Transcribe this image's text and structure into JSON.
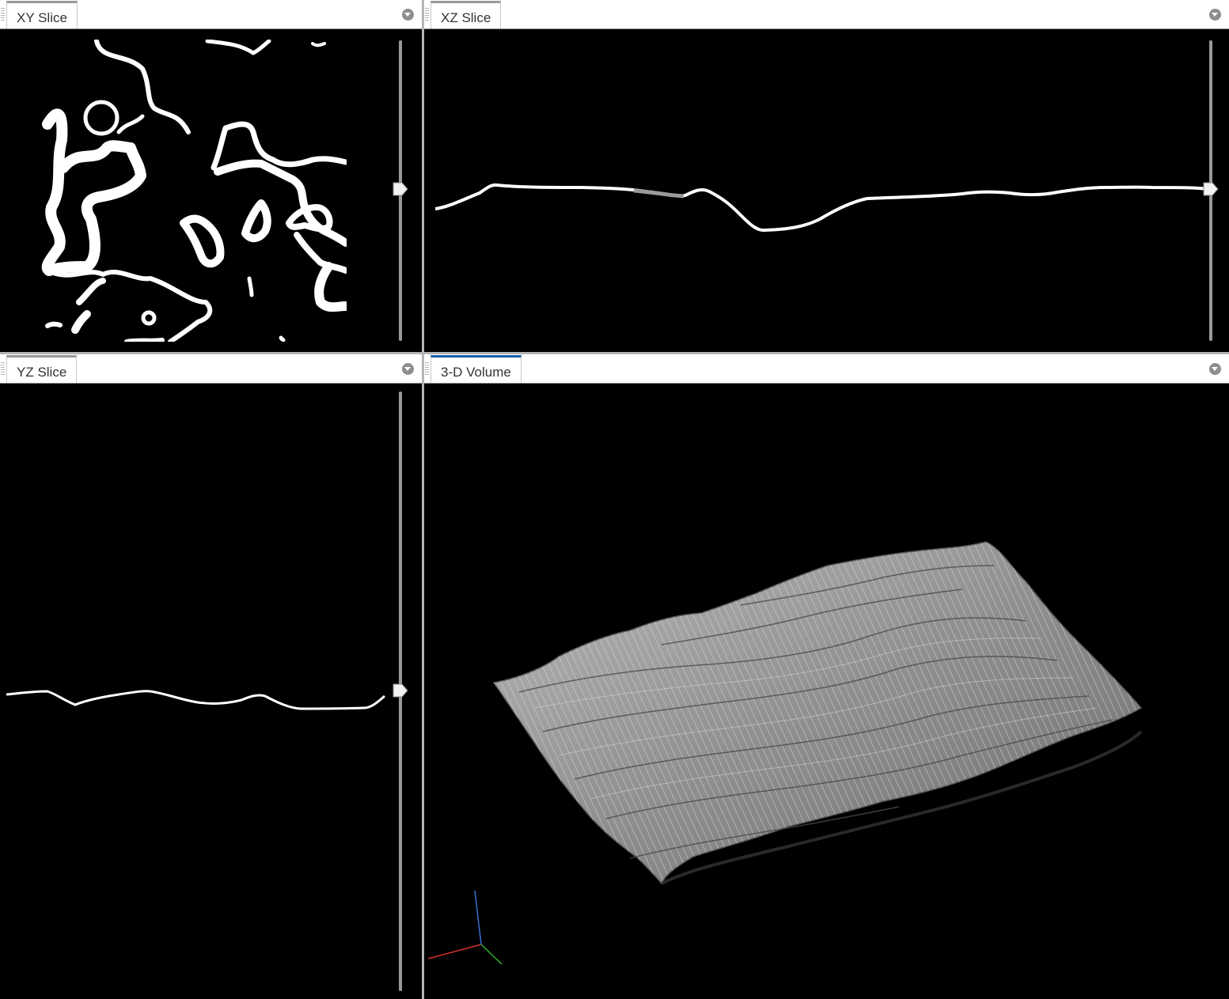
{
  "panels": {
    "xy": {
      "tab_label": "XY Slice",
      "slice_position": 0.5
    },
    "xz": {
      "tab_label": "XZ Slice",
      "slice_position": 0.5
    },
    "yz": {
      "tab_label": "YZ Slice",
      "slice_position": 0.5
    },
    "volume": {
      "tab_label": "3-D Volume"
    }
  },
  "icons": {
    "panel_menu": "chevron-down-circle-icon",
    "slider_thumb": "pentagon-arrow-icon",
    "axes": "xyz-axes-icon"
  },
  "colors": {
    "view_background": "#000000",
    "active_tab_accent": "#1a5fa8",
    "inactive_tab_accent": "#9a9a9a",
    "axis_x": "#d03030",
    "axis_y": "#30b030",
    "axis_z": "#3a6fd0"
  }
}
